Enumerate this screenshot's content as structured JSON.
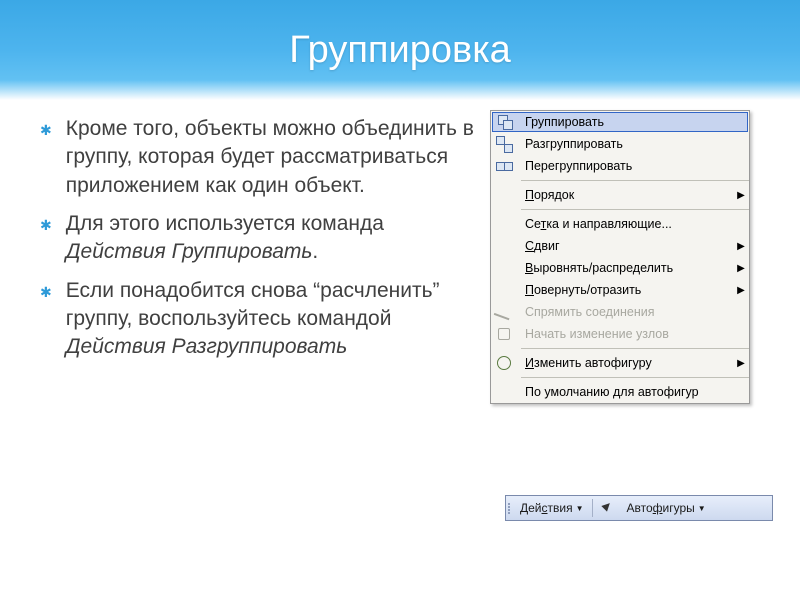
{
  "title": "Группировка",
  "bullets": [
    {
      "pre": "Кроме того, объекты можно объединить в группу, которая будет рассматриваться приложением как один объект."
    },
    {
      "pre": "Для этого используется команда ",
      "em": "Действия Группировать",
      "post": "."
    },
    {
      "pre": "Если понадобится снова “расчленить” группу, воспользуйтесь командой ",
      "em": "Действия Разгруппировать"
    }
  ],
  "menu": {
    "group": "Группировать",
    "ungroup": "Разгруппировать",
    "regroup": "Перегруппировать",
    "order": "Порядок",
    "grid": "Сетка и направляющие...",
    "nudge": "Сдвиг",
    "align": "Выровнять/распределить",
    "rotate": "Повернуть/отразить",
    "straighten": "Спрямить соединения",
    "editpoints": "Начать изменение узлов",
    "changeshape": "Изменить автофигуру",
    "defaults": "По умолчанию для автофигур"
  },
  "accel": {
    "order_u": "П",
    "order_rest": "орядок",
    "grid_u": "т",
    "grid_pre": "Се",
    "grid_post": "ка и направляющие...",
    "nudge_u": "С",
    "nudge_rest": "двиг",
    "align_u": "В",
    "align_rest": "ыровнять/распределить",
    "rotate_u": "П",
    "rotate_rest": "овернуть/отразить",
    "change_u": "И",
    "change_rest": "зменить автофигуру",
    "actions_u": "с",
    "actions_pre": "Дей",
    "actions_post": "твия",
    "autoshape_u": "ф",
    "autoshape_pre": "Авто",
    "autoshape_post": "игуры"
  },
  "toolbar": {
    "actions": "Действия",
    "autoshapes": "Автофигуры"
  }
}
